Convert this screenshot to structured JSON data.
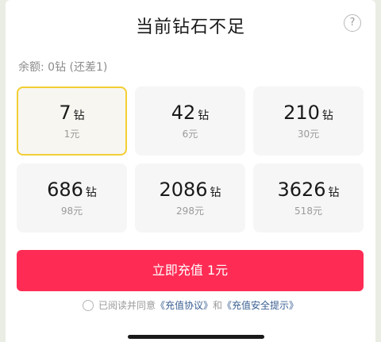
{
  "header": {
    "title": "当前钻石不足",
    "help_icon": "?"
  },
  "balance": {
    "text": "余额: 0钻 (还差1)"
  },
  "packages": [
    {
      "amount": "7",
      "unit": "钻",
      "price": "1元",
      "selected": true
    },
    {
      "amount": "42",
      "unit": "钻",
      "price": "6元",
      "selected": false
    },
    {
      "amount": "210",
      "unit": "钻",
      "price": "30元",
      "selected": false
    },
    {
      "amount": "686",
      "unit": "钻",
      "price": "98元",
      "selected": false
    },
    {
      "amount": "2086",
      "unit": "钻",
      "price": "298元",
      "selected": false
    },
    {
      "amount": "3626",
      "unit": "钻",
      "price": "518元",
      "selected": false
    }
  ],
  "pay_button": {
    "label": "立即充值 1元"
  },
  "agreement": {
    "prefix": "已阅读并同意",
    "link1": "《充值协议》",
    "and": "和",
    "link2": "《充值安全提示》",
    "checked": false
  },
  "colors": {
    "accent": "#fe2c55",
    "selected_border": "#f3cf33",
    "link": "#3a5f92"
  }
}
